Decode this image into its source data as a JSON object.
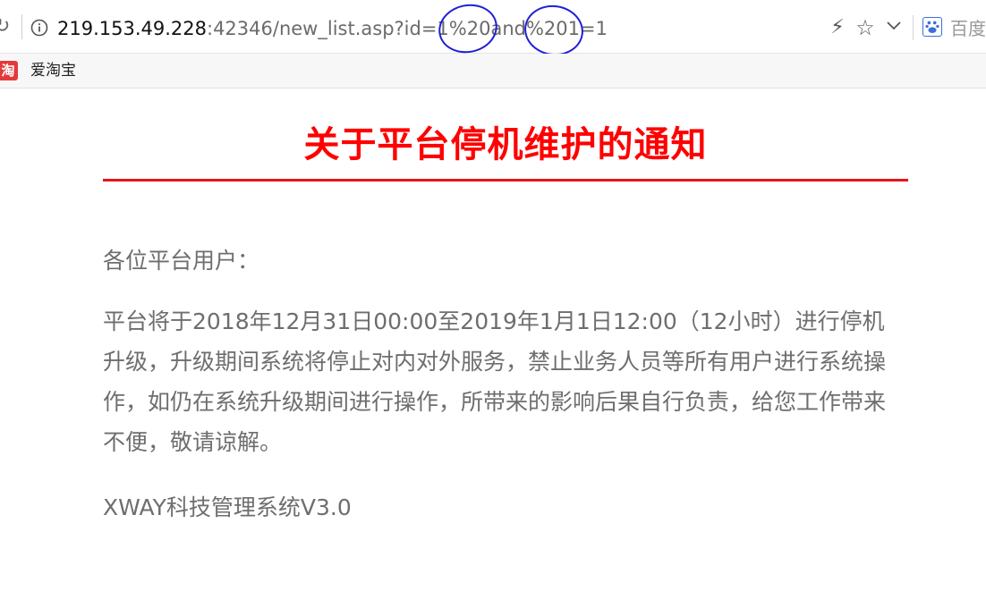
{
  "browser": {
    "url_host": "219.153.49.228",
    "url_rest": ":42346/new_list.asp?id=1%20and%201=1",
    "search_engine_label": "百度",
    "bookmarks": [
      {
        "icon_text": "淘",
        "label": "爱淘宝"
      }
    ],
    "icons": [
      "refresh-icon",
      "info-icon",
      "flash-icon",
      "star-icon",
      "chevron-down-icon",
      "baidu-icon"
    ],
    "annotation_color": "#1f1fd8"
  },
  "page": {
    "title": "关于平台停机维护的通知",
    "title_color": "#ff0000",
    "rule_color": "#e8141a",
    "greeting": "各位平台用户：",
    "paragraph": "平台将于2018年12月31日00:00至2019年1月1日12:00（12小时）进行停机升级，升级期间系统将停止对内对外服务，禁止业务人员等所有用户进行系统操作，如仍在系统升级期间进行操作，所带来的影响后果自行负责，给您工作带来不便，敬请谅解。",
    "signature": "XWAY科技管理系统V3.0"
  }
}
